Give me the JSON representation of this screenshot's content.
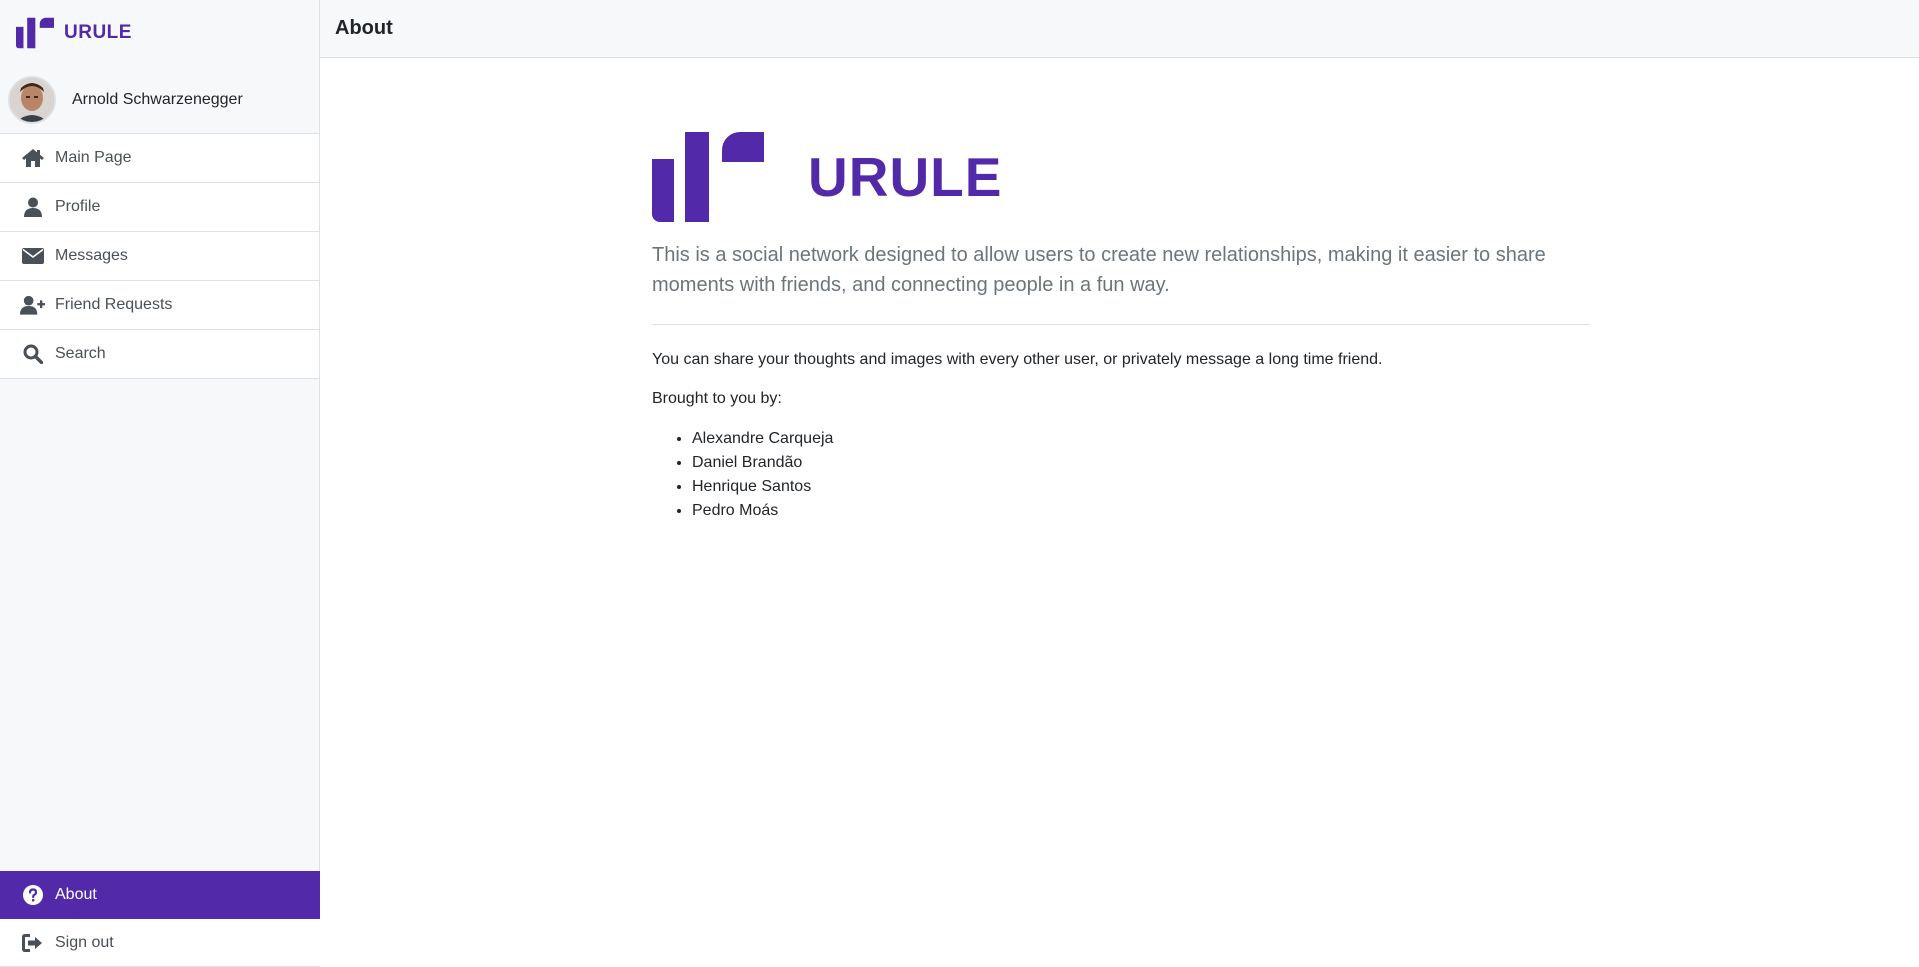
{
  "app": {
    "name": "URULE",
    "accent_color": "#5229a8"
  },
  "user": {
    "name": "Arnold Schwarzenegger",
    "avatar_icon": "avatar-photo"
  },
  "sidebar": {
    "items": [
      {
        "label": "Main Page",
        "icon": "home-icon"
      },
      {
        "label": "Profile",
        "icon": "user-icon"
      },
      {
        "label": "Messages",
        "icon": "envelope-icon"
      },
      {
        "label": "Friend Requests",
        "icon": "user-plus-icon"
      },
      {
        "label": "Search",
        "icon": "search-icon"
      }
    ],
    "bottom_items": [
      {
        "label": "About",
        "icon": "question-circle-icon",
        "active": true
      },
      {
        "label": "Sign out",
        "icon": "sign-out-icon",
        "active": false
      }
    ]
  },
  "header": {
    "title": "About"
  },
  "main": {
    "brand_name": "URULE",
    "lead": "This is a social network designed to allow users to create new relationships, making it easier to share moments with friends, and connecting people in a fun way.",
    "description": "You can share your thoughts and images with every other user, or privately message a long time friend.",
    "credits_heading": "Brought to you by:",
    "authors": [
      "Alexandre Carqueja",
      "Daniel Brandão",
      "Henrique Santos",
      "Pedro Moás"
    ]
  }
}
